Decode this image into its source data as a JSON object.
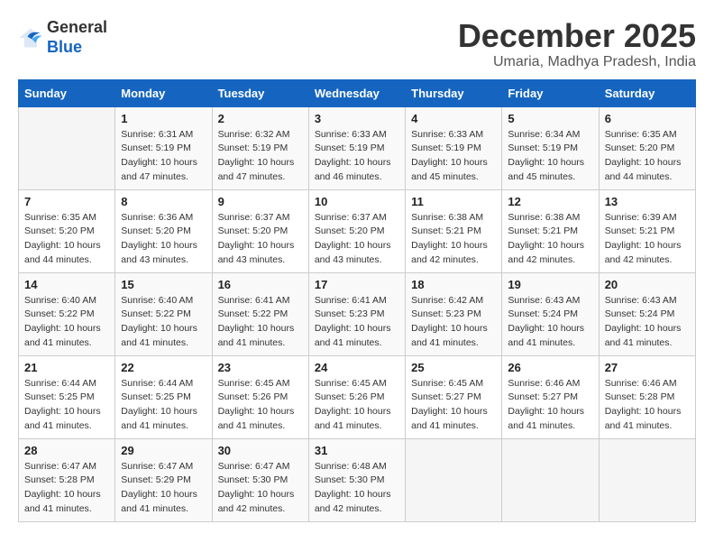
{
  "logo": {
    "text_general": "General",
    "text_blue": "Blue"
  },
  "title": "December 2025",
  "subtitle": "Umaria, Madhya Pradesh, India",
  "days_of_week": [
    "Sunday",
    "Monday",
    "Tuesday",
    "Wednesday",
    "Thursday",
    "Friday",
    "Saturday"
  ],
  "weeks": [
    [
      {
        "day": "",
        "info": ""
      },
      {
        "day": "1",
        "info": "Sunrise: 6:31 AM\nSunset: 5:19 PM\nDaylight: 10 hours\nand 47 minutes."
      },
      {
        "day": "2",
        "info": "Sunrise: 6:32 AM\nSunset: 5:19 PM\nDaylight: 10 hours\nand 47 minutes."
      },
      {
        "day": "3",
        "info": "Sunrise: 6:33 AM\nSunset: 5:19 PM\nDaylight: 10 hours\nand 46 minutes."
      },
      {
        "day": "4",
        "info": "Sunrise: 6:33 AM\nSunset: 5:19 PM\nDaylight: 10 hours\nand 45 minutes."
      },
      {
        "day": "5",
        "info": "Sunrise: 6:34 AM\nSunset: 5:19 PM\nDaylight: 10 hours\nand 45 minutes."
      },
      {
        "day": "6",
        "info": "Sunrise: 6:35 AM\nSunset: 5:20 PM\nDaylight: 10 hours\nand 44 minutes."
      }
    ],
    [
      {
        "day": "7",
        "info": "Sunrise: 6:35 AM\nSunset: 5:20 PM\nDaylight: 10 hours\nand 44 minutes."
      },
      {
        "day": "8",
        "info": "Sunrise: 6:36 AM\nSunset: 5:20 PM\nDaylight: 10 hours\nand 43 minutes."
      },
      {
        "day": "9",
        "info": "Sunrise: 6:37 AM\nSunset: 5:20 PM\nDaylight: 10 hours\nand 43 minutes."
      },
      {
        "day": "10",
        "info": "Sunrise: 6:37 AM\nSunset: 5:20 PM\nDaylight: 10 hours\nand 43 minutes."
      },
      {
        "day": "11",
        "info": "Sunrise: 6:38 AM\nSunset: 5:21 PM\nDaylight: 10 hours\nand 42 minutes."
      },
      {
        "day": "12",
        "info": "Sunrise: 6:38 AM\nSunset: 5:21 PM\nDaylight: 10 hours\nand 42 minutes."
      },
      {
        "day": "13",
        "info": "Sunrise: 6:39 AM\nSunset: 5:21 PM\nDaylight: 10 hours\nand 42 minutes."
      }
    ],
    [
      {
        "day": "14",
        "info": "Sunrise: 6:40 AM\nSunset: 5:22 PM\nDaylight: 10 hours\nand 41 minutes."
      },
      {
        "day": "15",
        "info": "Sunrise: 6:40 AM\nSunset: 5:22 PM\nDaylight: 10 hours\nand 41 minutes."
      },
      {
        "day": "16",
        "info": "Sunrise: 6:41 AM\nSunset: 5:22 PM\nDaylight: 10 hours\nand 41 minutes."
      },
      {
        "day": "17",
        "info": "Sunrise: 6:41 AM\nSunset: 5:23 PM\nDaylight: 10 hours\nand 41 minutes."
      },
      {
        "day": "18",
        "info": "Sunrise: 6:42 AM\nSunset: 5:23 PM\nDaylight: 10 hours\nand 41 minutes."
      },
      {
        "day": "19",
        "info": "Sunrise: 6:43 AM\nSunset: 5:24 PM\nDaylight: 10 hours\nand 41 minutes."
      },
      {
        "day": "20",
        "info": "Sunrise: 6:43 AM\nSunset: 5:24 PM\nDaylight: 10 hours\nand 41 minutes."
      }
    ],
    [
      {
        "day": "21",
        "info": "Sunrise: 6:44 AM\nSunset: 5:25 PM\nDaylight: 10 hours\nand 41 minutes."
      },
      {
        "day": "22",
        "info": "Sunrise: 6:44 AM\nSunset: 5:25 PM\nDaylight: 10 hours\nand 41 minutes."
      },
      {
        "day": "23",
        "info": "Sunrise: 6:45 AM\nSunset: 5:26 PM\nDaylight: 10 hours\nand 41 minutes."
      },
      {
        "day": "24",
        "info": "Sunrise: 6:45 AM\nSunset: 5:26 PM\nDaylight: 10 hours\nand 41 minutes."
      },
      {
        "day": "25",
        "info": "Sunrise: 6:45 AM\nSunset: 5:27 PM\nDaylight: 10 hours\nand 41 minutes."
      },
      {
        "day": "26",
        "info": "Sunrise: 6:46 AM\nSunset: 5:27 PM\nDaylight: 10 hours\nand 41 minutes."
      },
      {
        "day": "27",
        "info": "Sunrise: 6:46 AM\nSunset: 5:28 PM\nDaylight: 10 hours\nand 41 minutes."
      }
    ],
    [
      {
        "day": "28",
        "info": "Sunrise: 6:47 AM\nSunset: 5:28 PM\nDaylight: 10 hours\nand 41 minutes."
      },
      {
        "day": "29",
        "info": "Sunrise: 6:47 AM\nSunset: 5:29 PM\nDaylight: 10 hours\nand 41 minutes."
      },
      {
        "day": "30",
        "info": "Sunrise: 6:47 AM\nSunset: 5:30 PM\nDaylight: 10 hours\nand 42 minutes."
      },
      {
        "day": "31",
        "info": "Sunrise: 6:48 AM\nSunset: 5:30 PM\nDaylight: 10 hours\nand 42 minutes."
      },
      {
        "day": "",
        "info": ""
      },
      {
        "day": "",
        "info": ""
      },
      {
        "day": "",
        "info": ""
      }
    ]
  ]
}
